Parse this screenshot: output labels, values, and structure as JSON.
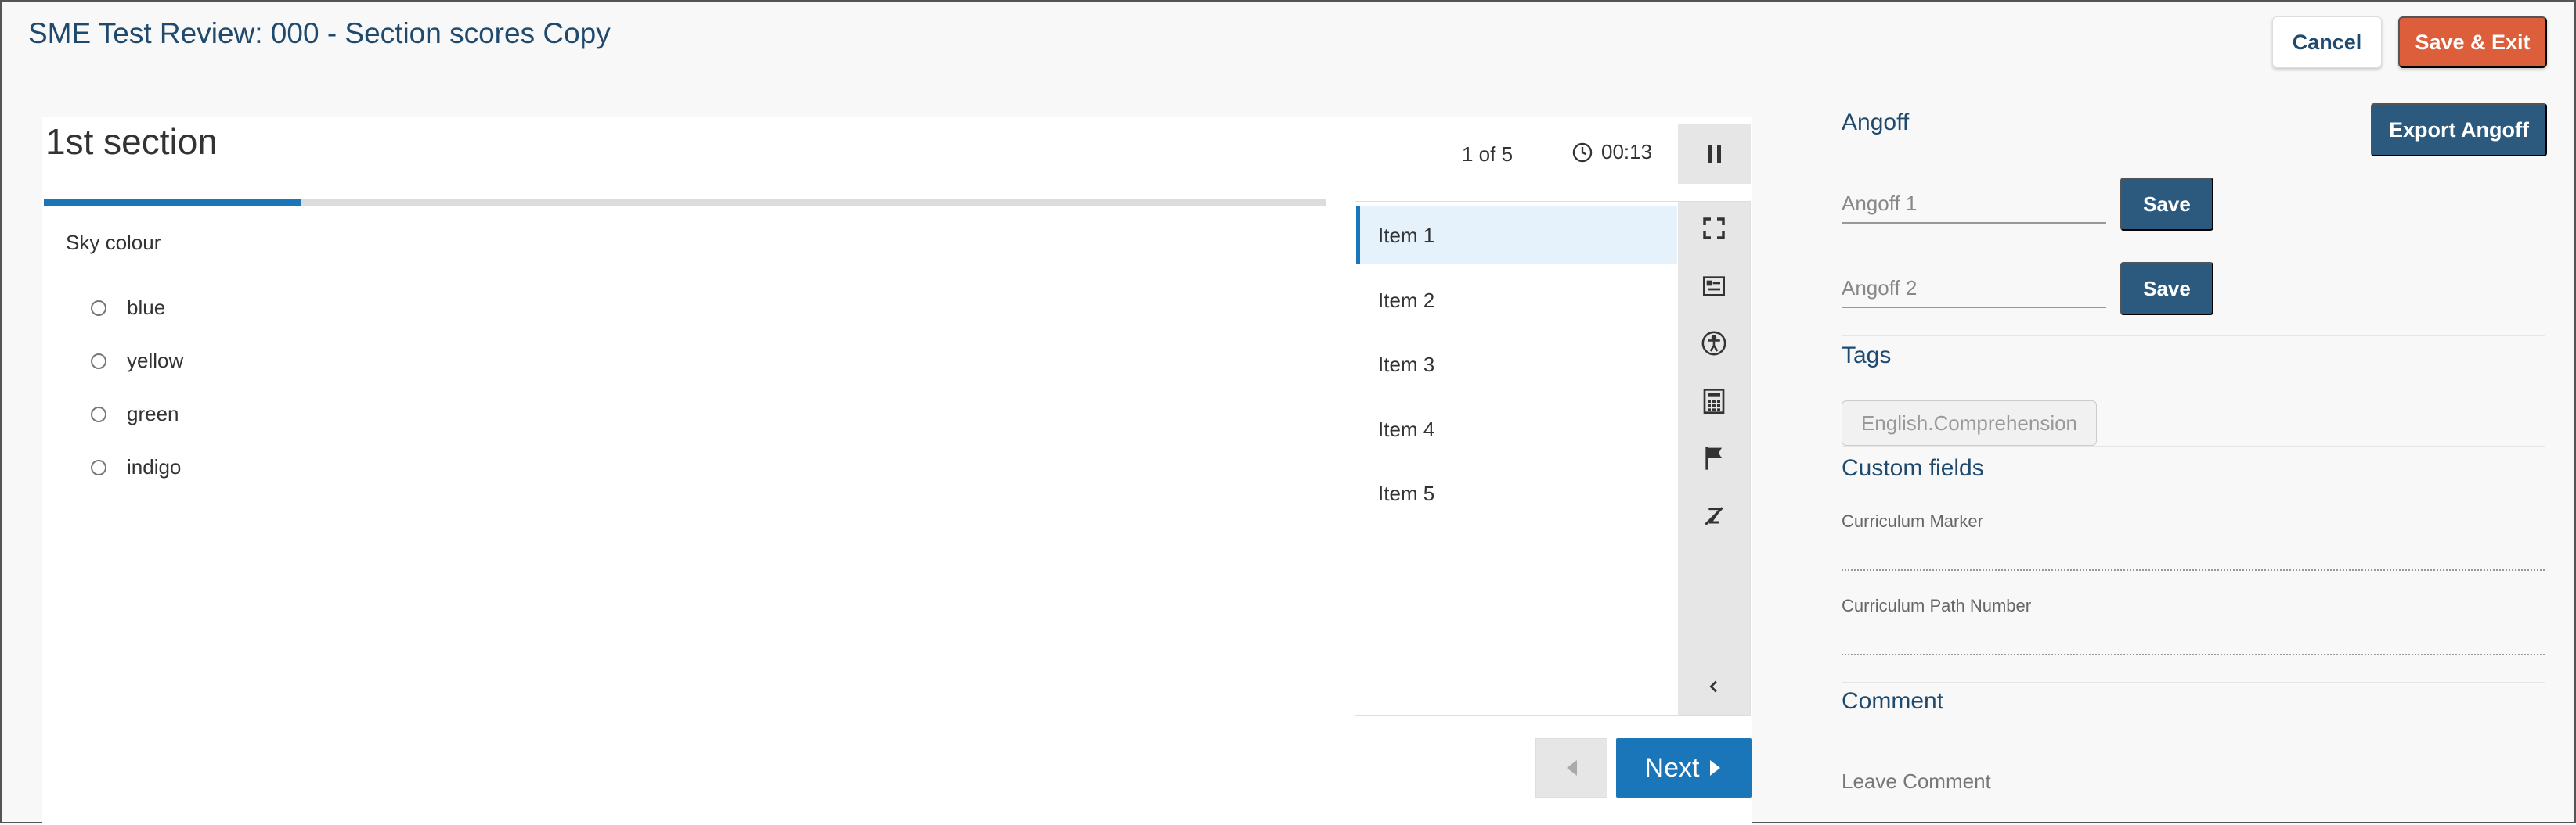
{
  "header": {
    "title": "SME Test Review: 000 - Section scores Copy",
    "cancel_label": "Cancel",
    "save_exit_label": "Save & Exit"
  },
  "section": {
    "title": "1st section",
    "progress": 0.2,
    "counter": "1 of 5",
    "timer": "00:13"
  },
  "question": {
    "text": "Sky colour",
    "options": [
      "blue",
      "yellow",
      "green",
      "indigo"
    ]
  },
  "items": [
    "Item 1",
    "Item 2",
    "Item 3",
    "Item 4",
    "Item 5"
  ],
  "active_item": 0,
  "tools": [
    "fullscreen-icon",
    "list-details-icon",
    "accessibility-icon",
    "calculator-icon",
    "flag-icon",
    "strikethrough-icon"
  ],
  "nav": {
    "next_label": "Next"
  },
  "angoff": {
    "heading": "Angoff",
    "export_label": "Export Angoff",
    "input1_placeholder": "Angoff 1",
    "input2_placeholder": "Angoff 2",
    "save_label": "Save"
  },
  "tags": {
    "heading": "Tags",
    "items": [
      "English.Comprehension"
    ]
  },
  "custom_fields": {
    "heading": "Custom fields",
    "fields": [
      "Curriculum Marker",
      "Curriculum Path Number"
    ]
  },
  "comment": {
    "heading": "Comment",
    "placeholder": "Leave Comment"
  },
  "colors": {
    "accent": "#1b75b9",
    "dark_blue": "#2b5a7e",
    "save_exit": "#dd5e3b"
  }
}
